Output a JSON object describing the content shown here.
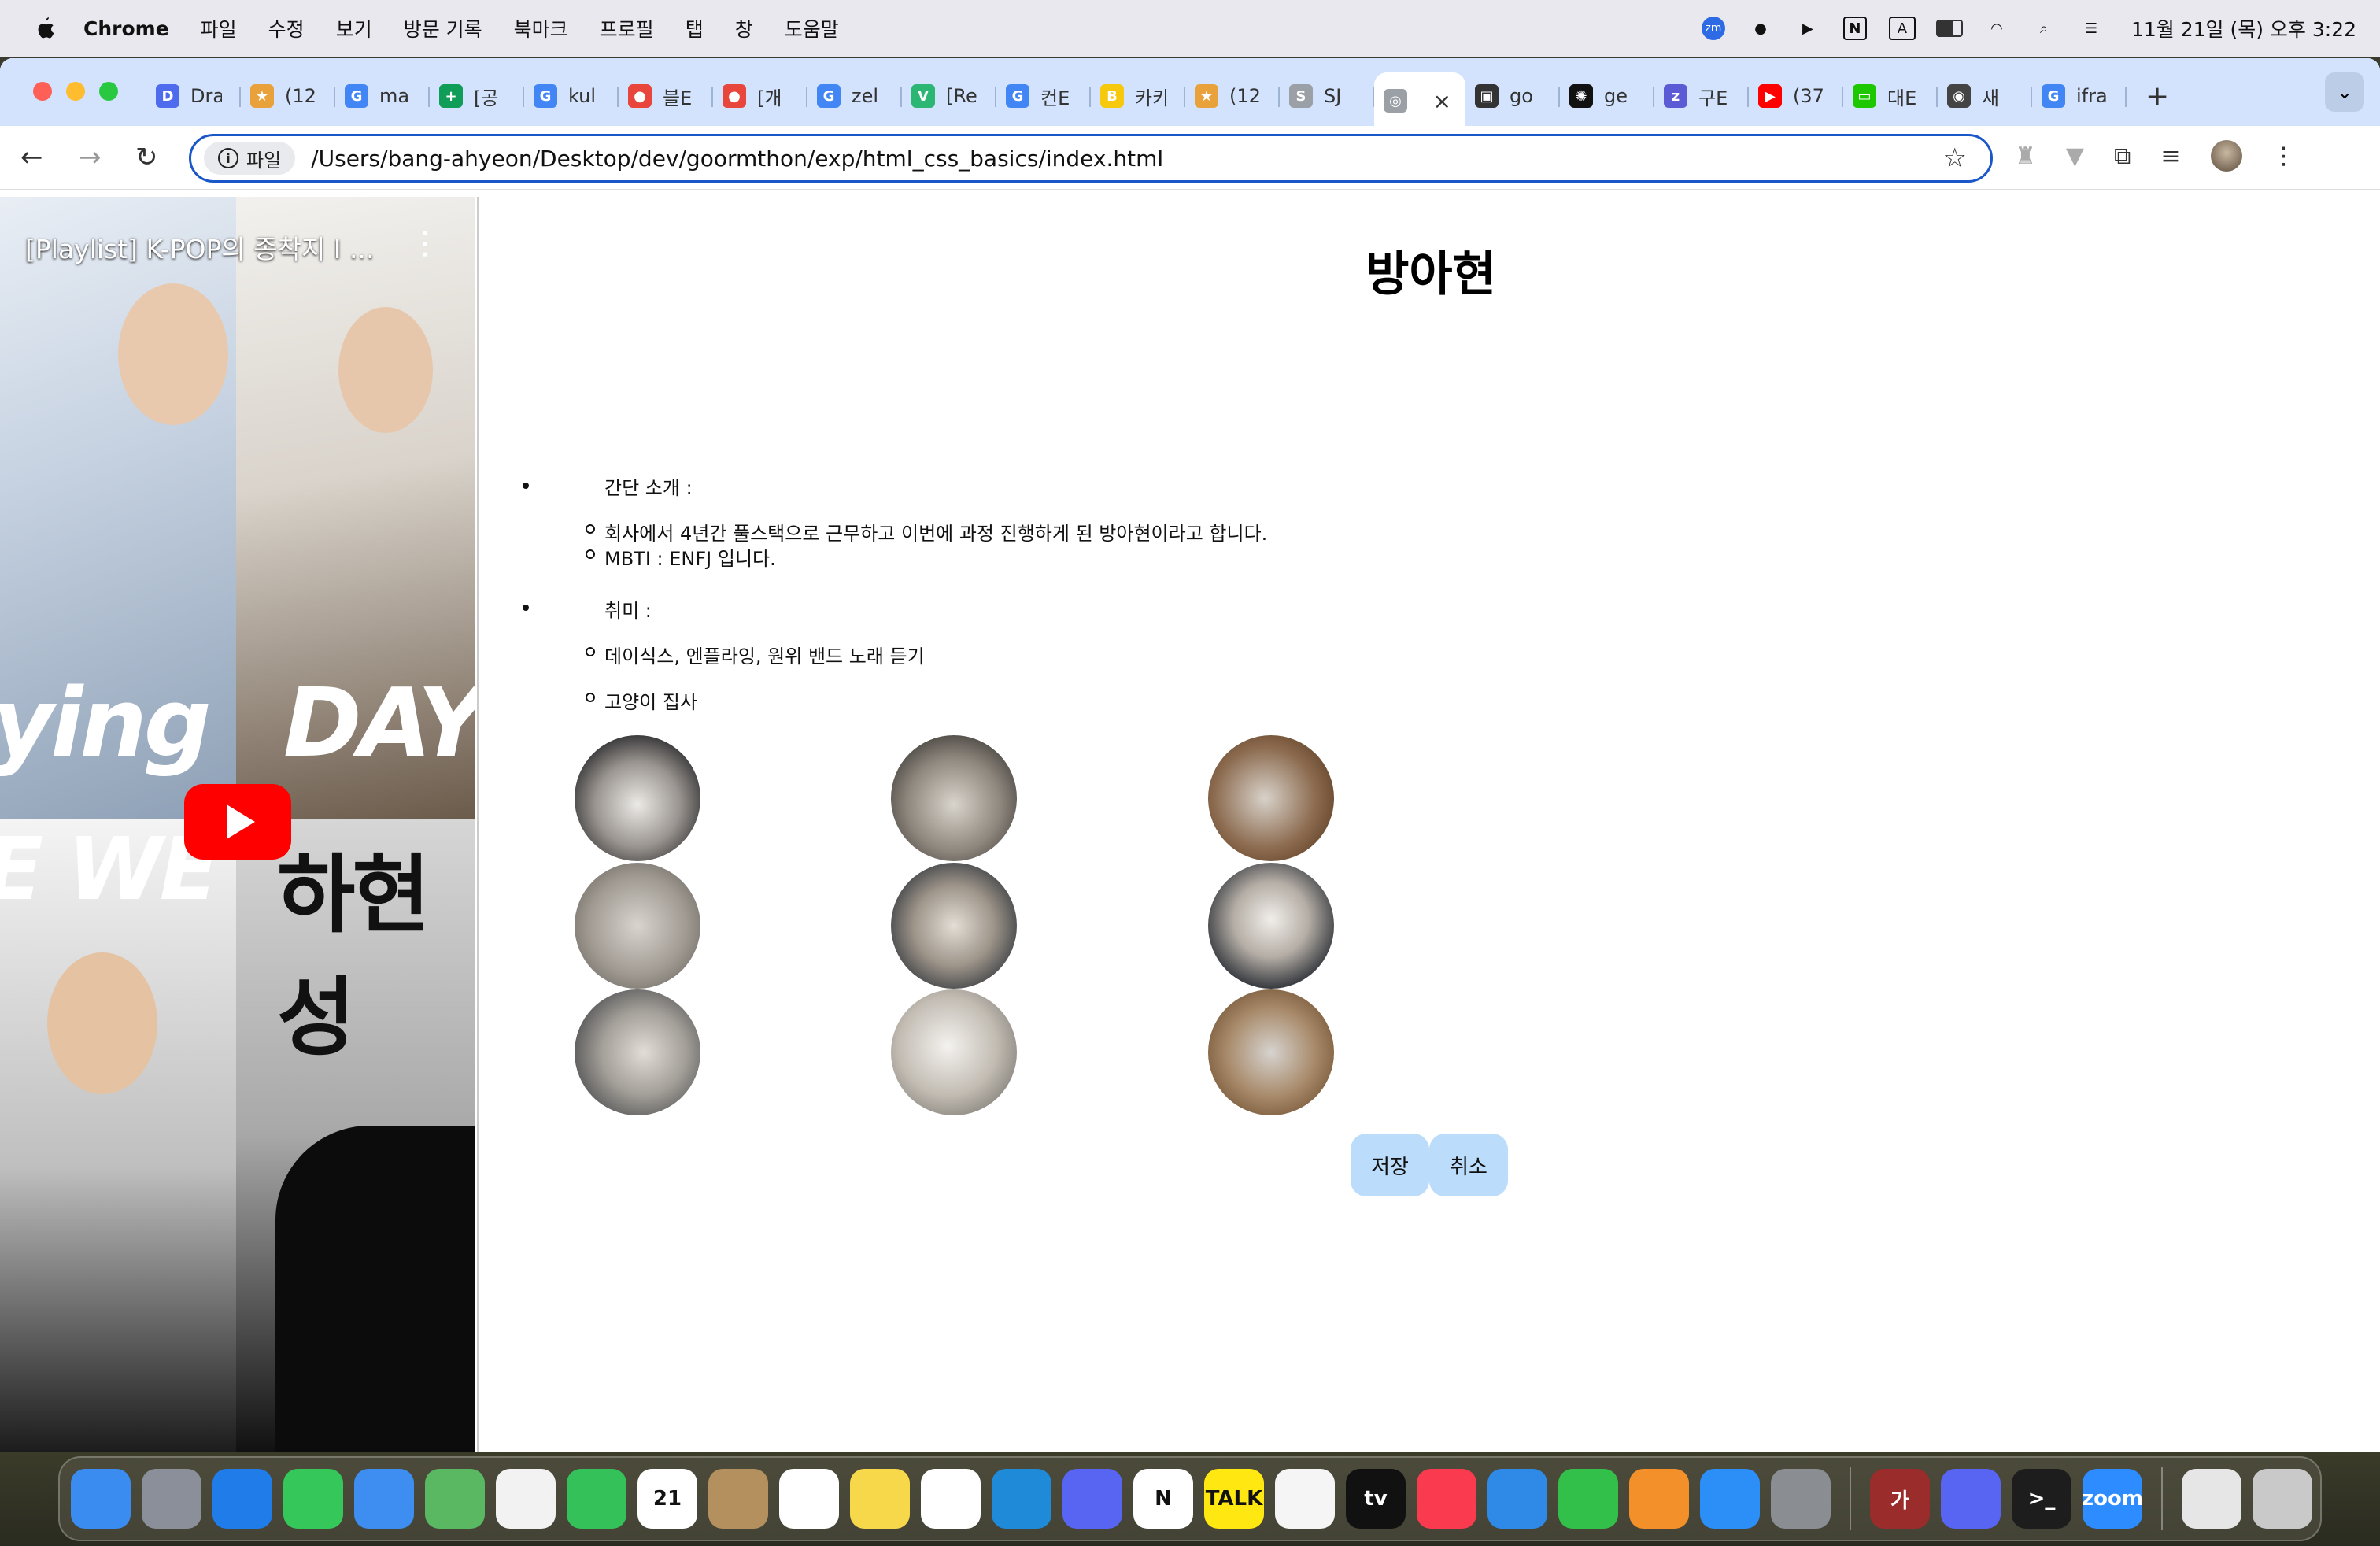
{
  "menubar": {
    "app": "Chrome",
    "items": [
      "파일",
      "수정",
      "보기",
      "방문 기록",
      "북마크",
      "프로필",
      "탭",
      "창",
      "도움말"
    ],
    "clock": "11월 21일 (목) 오후 3:22",
    "tray": [
      "zm",
      "N",
      "A"
    ]
  },
  "tabs": [
    {
      "title": "Dra",
      "color": "#4f6bed",
      "icon": "D"
    },
    {
      "title": "(12",
      "color": "#e9a23b",
      "icon": "★"
    },
    {
      "title": "ma",
      "color": "#4285f4",
      "icon": "G"
    },
    {
      "title": "[공",
      "color": "#0f9d58",
      "icon": "+"
    },
    {
      "title": "kul",
      "color": "#4285f4",
      "icon": "G"
    },
    {
      "title": "블E",
      "color": "#e8453c",
      "icon": "●"
    },
    {
      "title": "[개",
      "color": "#e8453c",
      "icon": "●"
    },
    {
      "title": "zel",
      "color": "#4285f4",
      "icon": "G"
    },
    {
      "title": "[Re",
      "color": "#2bb673",
      "icon": "V"
    },
    {
      "title": "컨E",
      "color": "#4285f4",
      "icon": "G"
    },
    {
      "title": "카카",
      "color": "#f6c90e",
      "icon": "B"
    },
    {
      "title": "(12",
      "color": "#e9a23b",
      "icon": "★"
    },
    {
      "title": "SJ",
      "color": "#9aa0a6",
      "icon": "S"
    },
    {
      "title": "",
      "color": "#9aa0a6",
      "icon": "◎",
      "active": true
    },
    {
      "title": "go",
      "color": "#333333",
      "icon": "▣"
    },
    {
      "title": "ge",
      "color": "#111111",
      "icon": "✺"
    },
    {
      "title": "구E",
      "color": "#5b5bd6",
      "icon": "z"
    },
    {
      "title": "(37",
      "color": "#ff0000",
      "icon": "▶"
    },
    {
      "title": "대E",
      "color": "#1ec800",
      "icon": "▭"
    },
    {
      "title": "새",
      "color": "#444444",
      "icon": "◉"
    },
    {
      "title": "ifra",
      "color": "#4285f4",
      "icon": "G"
    }
  ],
  "address": {
    "chip": "파일",
    "url": "/Users/bang-ahyeon/Desktop/dev/goormthon/exp/html_css_basics/index.html"
  },
  "video": {
    "title": "[Playlist] K-POP의 종착지 I ...",
    "text1": "ying",
    "text2": "DAY",
    "text3": "E WE",
    "text4": "하현성"
  },
  "page": {
    "heading": "방아현",
    "intro_label": "간단 소개 :",
    "intro_items": [
      "회사에서 4년간 풀스택으로 근무하고 이번에 과정 진행하게 된 방아현이라고 합니다.",
      "MBTI : ENFJ 입니다."
    ],
    "hobby_label": "취미 :",
    "hobby_items": [
      "데이식스, 엔플라잉, 원위 밴드 노래 듣기",
      "고양이 집사"
    ],
    "cat_photos": [
      "cat-photo-1",
      "cat-photo-2",
      "cat-photo-3",
      "cat-photo-4",
      "cat-photo-5",
      "cat-photo-6",
      "cat-photo-7",
      "cat-photo-8",
      "cat-photo-9"
    ],
    "save_label": "저장",
    "cancel_label": "취소"
  },
  "dock": [
    {
      "name": "finder",
      "color": "#3b8cf0"
    },
    {
      "name": "launchpad",
      "color": "#8a8f99"
    },
    {
      "name": "safari",
      "color": "#1f7ce8"
    },
    {
      "name": "messages",
      "color": "#35c759"
    },
    {
      "name": "mail",
      "color": "#3d8ef0"
    },
    {
      "name": "maps",
      "color": "#59b861"
    },
    {
      "name": "photos",
      "color": "#f2f2f2"
    },
    {
      "name": "facetime",
      "color": "#34c15a"
    },
    {
      "name": "calendar",
      "color": "#ffffff",
      "label": "21"
    },
    {
      "name": "contacts",
      "color": "#b4905e"
    },
    {
      "name": "reminders",
      "color": "#ffffff"
    },
    {
      "name": "notes",
      "color": "#f7d84a"
    },
    {
      "name": "chrome",
      "color": "#ffffff"
    },
    {
      "name": "vscode",
      "color": "#1f8ad8"
    },
    {
      "name": "discord",
      "color": "#5865f2"
    },
    {
      "name": "notion",
      "color": "#ffffff",
      "label": "N"
    },
    {
      "name": "kakaotalk",
      "color": "#ffe812",
      "label": "TALK"
    },
    {
      "name": "freeform",
      "color": "#f5f5f5"
    },
    {
      "name": "appletv",
      "color": "#111111",
      "label": "tv"
    },
    {
      "name": "music",
      "color": "#fa3b4f"
    },
    {
      "name": "keynote",
      "color": "#2e8ae6"
    },
    {
      "name": "numbers",
      "color": "#33c04a"
    },
    {
      "name": "pages",
      "color": "#f4902a"
    },
    {
      "name": "appstore",
      "color": "#2c8ef7"
    },
    {
      "name": "settings",
      "color": "#8a8d92"
    },
    {
      "name": "dictionary",
      "color": "#9b2c2c",
      "label": "가"
    },
    {
      "name": "discord-2",
      "color": "#5865f2"
    },
    {
      "name": "terminal",
      "color": "#1d1d1d",
      "label": ">_"
    },
    {
      "name": "zoom",
      "color": "#2d8cff",
      "label": "zoom"
    },
    {
      "name": "files",
      "color": "#e6e6e6"
    },
    {
      "name": "trash",
      "color": "#c9c9c9"
    }
  ]
}
